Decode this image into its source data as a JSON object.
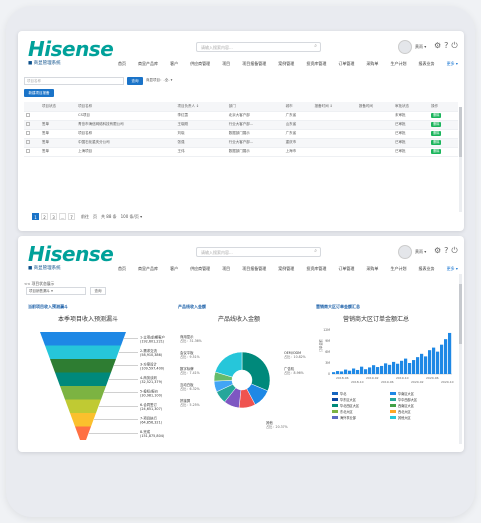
{
  "brand": {
    "logo": "Hisense",
    "system": "■ 商显管理系统"
  },
  "header": {
    "search_placeholder": "请输入搜索内容...",
    "user": "黄雨 ▾",
    "icons": [
      "gear-icon",
      "help-icon",
      "power-icon"
    ]
  },
  "nav": [
    "首页",
    "商显产品库",
    "客户",
    "供应商管理",
    "项目",
    "项目报备管理",
    "案例管理",
    "投资库管理",
    "订单管理",
    "采购单",
    "生产计划",
    "报表业务",
    "更多 ▾"
  ],
  "screen1": {
    "filter_placeholder": "项目名称",
    "query_btn": "查询",
    "select_label": "商显项目：-全- ▾",
    "new_btn": "新建项目报备",
    "columns": [
      "",
      "项目状态",
      "项目名称",
      "项目负责人 ↕",
      "部门",
      "城市",
      "报备时间 ↕",
      "报备时间",
      "审批状态",
      "操作"
    ],
    "rows": [
      [
        "",
        "",
        "CS项目",
        "李红霞",
        "北京大客户部",
        "广东省",
        "",
        "",
        "未审批",
        "删除"
      ],
      [
        "",
        "签单",
        "青岛市海信网络科技有限公司",
        "王晓刚",
        "行业大客户部...",
        "山东省",
        "",
        "",
        "已审批",
        "删除"
      ],
      [
        "",
        "签单",
        "项目名称",
        "刘晓",
        "数据部门展示",
        "广东省",
        "",
        "",
        "已审批",
        "删除"
      ],
      [
        "",
        "签单",
        "中国石化重庆分公司",
        "张强",
        "行业大客户部...",
        "重庆市",
        "",
        "",
        "已审批",
        "删除"
      ],
      [
        "",
        "签单",
        "上海项目",
        "王伟",
        "数据部门展示",
        "上海市",
        "",
        "",
        "已审批",
        "删除"
      ]
    ],
    "pager": {
      "pages": [
        "1",
        "2",
        "3",
        "…",
        "7"
      ],
      "goto": "前往",
      "page_unit": "页",
      "total": "共 88 条",
      "per_page": "100 条/页 ▾"
    }
  },
  "screen2": {
    "crumb": "<< 项目状态展示",
    "filter_select": "项目销售漏斗 ▾",
    "filter_btn": "查询",
    "panels": {
      "funnel": {
        "label": "当前项目收入预测漏斗",
        "title": "本季项目收入预测漏斗"
      },
      "pie": {
        "label": "产品线收入金额",
        "title": "产品线收入金额"
      },
      "area": {
        "label": "营销商大区订单金额汇总",
        "title": "营销商大区订单金额汇总"
      }
    }
  },
  "chart_data": [
    {
      "type": "funnel",
      "title": "本季项目收入预测漏斗",
      "categories": [
        "1-立项/前期",
        "2-需求交流",
        "3-方案设计",
        "4-商务谈判",
        "5-投标/报价",
        "6-合同签订",
        "7-项目执行",
        "8-完成"
      ],
      "values": [
        {
          "label": "1-立项/前期客户\n(192,601,221)",
          "value": 192601221
        },
        {
          "label": "2-需求交流\n(58,910,386)",
          "value": 58910386
        },
        {
          "label": "3-方案设计\n(109,597,400)",
          "value": 109597400
        },
        {
          "label": "4-商务谈判\n(32,521,379)",
          "value": 32521379
        },
        {
          "label": "5-投标/报价\n(30,981,100)",
          "value": 30981100
        },
        {
          "label": "6-合同签订\n(24,651,307)",
          "value": 24651307
        },
        {
          "label": "7-项目执行\n(64,856,321)",
          "value": 64856321
        },
        {
          "label": "8-完成\n(151,875,804)",
          "value": 151875804
        }
      ],
      "colors": [
        "#1e88e5",
        "#26c6da",
        "#2e7d32",
        "#00897b",
        "#7cb342",
        "#c0ca33",
        "#fbc02d",
        "#ff7043"
      ]
    },
    {
      "type": "pie",
      "title": "产品线收入金额",
      "series": [
        {
          "name": "广告机",
          "share": 31.36,
          "color": "#00897b"
        },
        {
          "name": "显示器",
          "share": 10.82,
          "color": "#1e88e5"
        },
        {
          "name": "会议平板",
          "share": 9.51,
          "color": "#ef5350"
        },
        {
          "name": "拼接屏",
          "share": 8.96,
          "color": "#7e57c2"
        },
        {
          "name": "数字标牌",
          "share": 7.41,
          "color": "#26a69a"
        },
        {
          "name": "互动白板",
          "share": 6.32,
          "color": "#42a5f5"
        },
        {
          "name": "LED",
          "share": 5.25,
          "color": "#66bb6a"
        },
        {
          "name": "其他",
          "share": 20.37,
          "color": "#26c6da"
        }
      ],
      "labels": [
        {
          "name": "商用显示",
          "pct": "占比：31.36%"
        },
        {
          "name": "会议平板",
          "pct": "占比：9.51%"
        },
        {
          "name": "数字标牌",
          "pct": "占比：7.41%"
        },
        {
          "name": "互动白板",
          "pct": "占比：6.32%"
        },
        {
          "name": "拼接屏",
          "pct": "占比：5.25%"
        },
        {
          "name": "OEM/ODM",
          "pct": "占比：10.82%"
        },
        {
          "name": "广告机",
          "pct": "占比：8.96%"
        },
        {
          "name": "其他",
          "pct": "占比：20.37%"
        }
      ]
    },
    {
      "type": "area",
      "title": "营销商大区订单金额汇总",
      "ylabel": "订单金额",
      "yticks": [
        "12M",
        "9M",
        "6M",
        "3M",
        "0"
      ],
      "x_ticks": [
        "2018-06",
        "2018-10",
        "2019-02",
        "2019-06",
        "2019-10",
        "2020-02",
        "2020-06",
        "2020-10"
      ],
      "values": [
        0.5,
        0.8,
        0.7,
        1.2,
        0.9,
        1.5,
        1.1,
        2.0,
        1.3,
        1.8,
        2.4,
        1.9,
        2.2,
        2.9,
        2.5,
        3.3,
        2.8,
        3.6,
        4.2,
        3.0,
        3.8,
        4.6,
        5.5,
        4.8,
        6.5,
        7.2,
        6.1,
        8.0,
        9.5,
        11.2
      ],
      "legend": [
        "华北",
        "华南区大区",
        "华东区大区",
        "华中西部大区",
        "华北西区大区",
        "西南区大区",
        "东北大区",
        "西北大区",
        "海外事业部",
        "其他大区"
      ],
      "legend_colors": [
        "#1565c0",
        "#1e88e5",
        "#0d47a1",
        "#26a69a",
        "#00897b",
        "#43a047",
        "#7cb342",
        "#ffa726",
        "#5c6bc0",
        "#26c6da"
      ]
    }
  ]
}
